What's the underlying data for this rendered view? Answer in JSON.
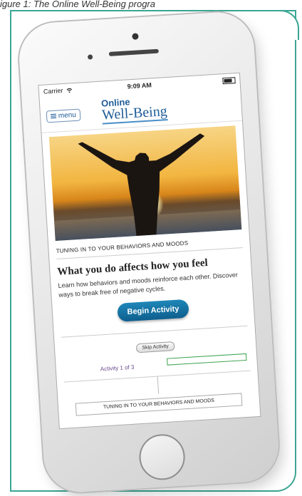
{
  "caption": "igure 1: The Online Well-Being progra",
  "status_bar": {
    "carrier": "Carrier",
    "time": "9:09 AM"
  },
  "header": {
    "menu_label": "menu",
    "logo_top": "Online",
    "logo_main": "Well-Being"
  },
  "module": {
    "section_label": "TUNING IN TO YOUR BEHAVIORS AND MOODS",
    "headline": "What you do affects how you feel",
    "description": "Learn how behaviors and moods reinforce each other. Discover ways to break free of negative cycles.",
    "begin_button": "Begin Activity",
    "skip_button": "Skip Activity",
    "progress_text": "Activity 1 of 3",
    "progress_value": 0.0,
    "next_section_label": "TUNING IN TO YOUR BEHAVIORS AND MOODS"
  },
  "colors": {
    "frame_border": "#3aa592",
    "brand_blue": "#1f5c99",
    "button_blue": "#1f87b8",
    "progress_green": "#3aa14b",
    "progress_text": "#6a4a8a"
  },
  "icons": [
    "hamburger-menu-icon",
    "wifi-icon",
    "battery-icon"
  ]
}
